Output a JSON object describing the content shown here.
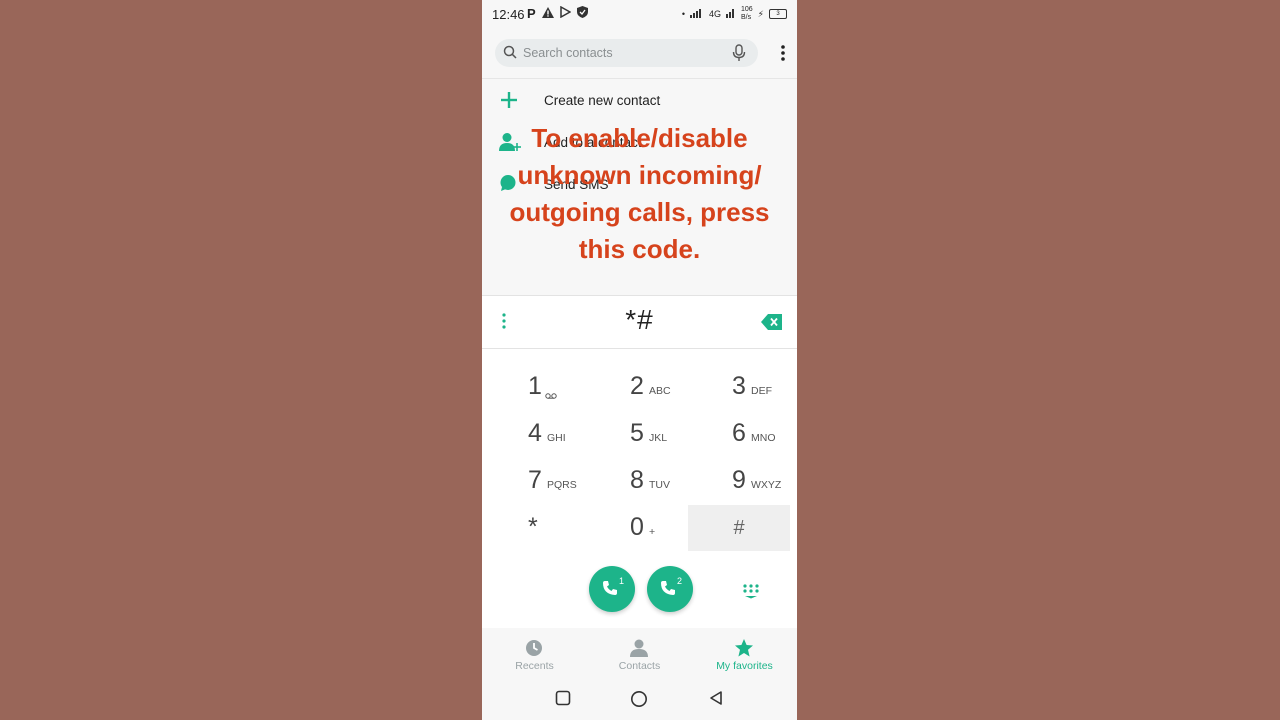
{
  "status_bar": {
    "time": "12:46",
    "left_icons": [
      "p-icon",
      "warning-icon",
      "play-store-icon",
      "shield-icon"
    ],
    "network": "4G",
    "speed": "106",
    "speed_unit": "B/s",
    "battery": "3"
  },
  "search": {
    "placeholder": "Search contacts"
  },
  "actions": [
    {
      "label": "Create new contact",
      "icon": "plus-icon"
    },
    {
      "label": "Add to a contact",
      "icon": "add-person-icon"
    },
    {
      "label": "Send SMS",
      "icon": "message-icon"
    }
  ],
  "overlay_text": "To enable/disable\nunknown incoming/\noutgoing calls, press\nthis code.",
  "dialer": {
    "digits": "*#"
  },
  "keypad": [
    {
      "num": "1",
      "letters": ""
    },
    {
      "num": "2",
      "letters": "ABC"
    },
    {
      "num": "3",
      "letters": "DEF"
    },
    {
      "num": "4",
      "letters": "GHI"
    },
    {
      "num": "5",
      "letters": "JKL"
    },
    {
      "num": "6",
      "letters": "MNO"
    },
    {
      "num": "7",
      "letters": "PQRS"
    },
    {
      "num": "8",
      "letters": "TUV"
    },
    {
      "num": "9",
      "letters": "WXYZ"
    },
    {
      "num": "*",
      "letters": ""
    },
    {
      "num": "0",
      "letters": "+"
    },
    {
      "num": "#",
      "letters": ""
    }
  ],
  "call_buttons": [
    {
      "sim": "1"
    },
    {
      "sim": "2"
    }
  ],
  "bottom_nav": [
    {
      "label": "Recents",
      "icon": "clock-icon",
      "active": false
    },
    {
      "label": "Contacts",
      "icon": "person-icon",
      "active": false
    },
    {
      "label": "My favorites",
      "icon": "star-icon",
      "active": true
    }
  ],
  "colors": {
    "accent": "#1db48a",
    "overlay_text": "#d6431c",
    "background": "#996659"
  }
}
